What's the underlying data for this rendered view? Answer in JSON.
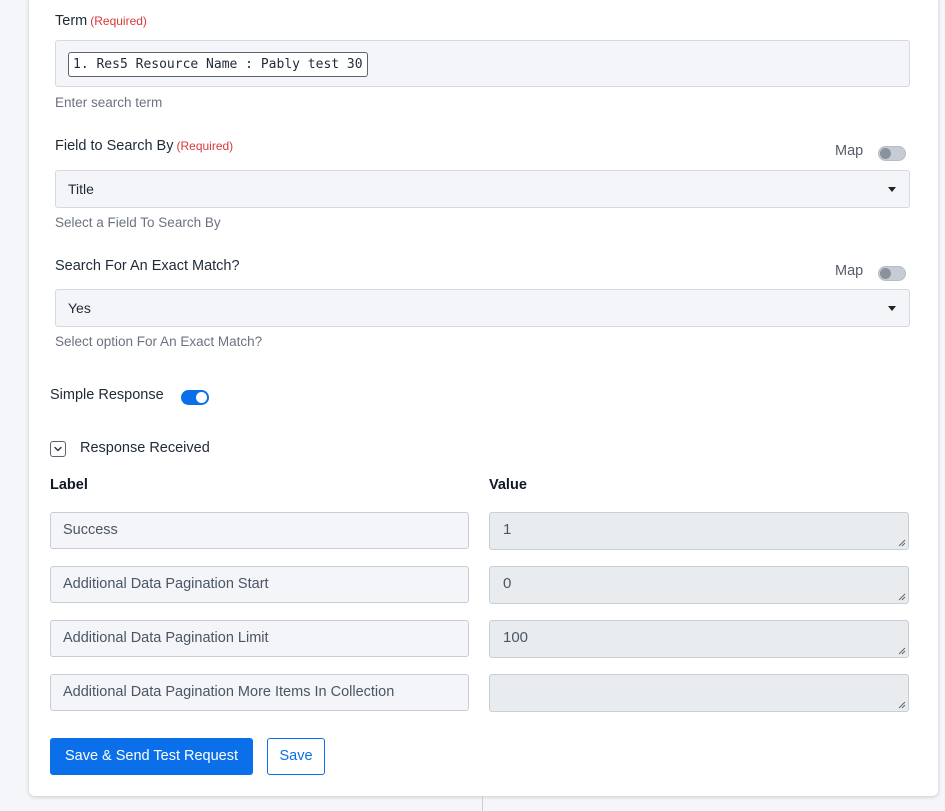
{
  "term": {
    "label": "Term",
    "required": "(Required)",
    "token": "1. Res5 Resource Name : Pably test 30",
    "help": "Enter search term"
  },
  "search_by": {
    "label": "Field to Search By",
    "required": "(Required)",
    "map_label": "Map",
    "map_enabled": false,
    "selected": "Title",
    "help": "Select a Field To Search By"
  },
  "exact_match": {
    "label": "Search For An Exact Match?",
    "map_label": "Map",
    "map_enabled": false,
    "selected": "Yes",
    "help": "Select option For An Exact Match?"
  },
  "simple_response": {
    "label": "Simple Response",
    "enabled": true
  },
  "response": {
    "title": "Response Received",
    "label_header": "Label",
    "value_header": "Value",
    "rows": [
      {
        "label": "Success",
        "value": "1"
      },
      {
        "label": "Additional Data Pagination Start",
        "value": "0"
      },
      {
        "label": "Additional Data Pagination Limit",
        "value": "100"
      },
      {
        "label": "Additional Data Pagination More Items In Collection",
        "value": ""
      }
    ]
  },
  "buttons": {
    "save_send": "Save & Send Test Request",
    "save": "Save"
  },
  "colors": {
    "accent": "#0a6fe8",
    "required": "#d9383a"
  }
}
